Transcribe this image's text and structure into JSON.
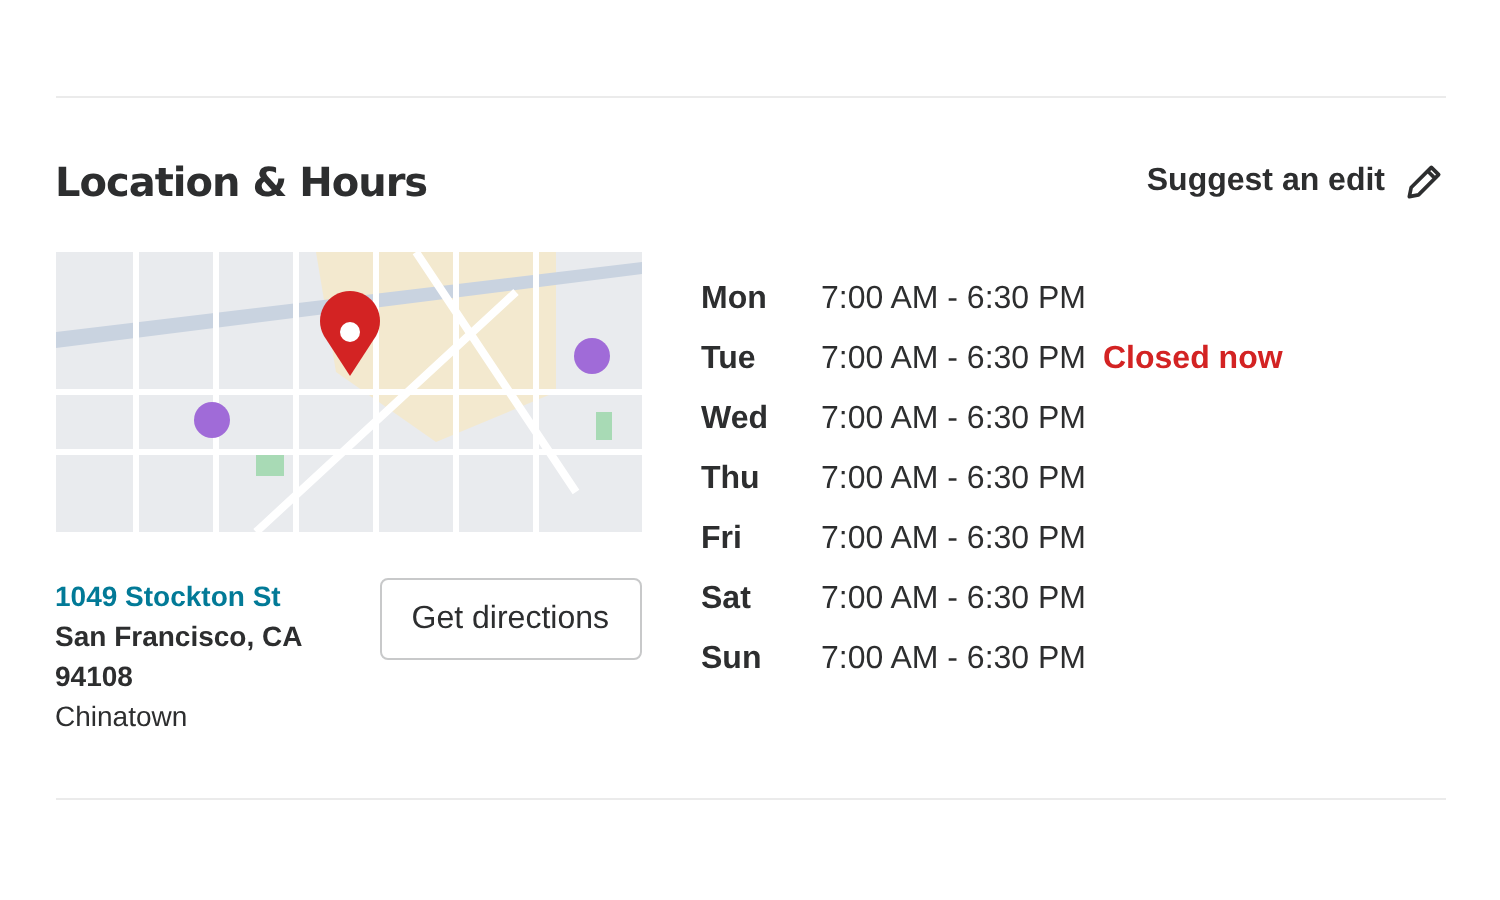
{
  "section": {
    "title": "Location & Hours",
    "suggest_edit": "Suggest an edit"
  },
  "address": {
    "street": "1049 Stockton St",
    "lines": [
      "San Francisco, CA",
      "94108",
      "Chinatown"
    ]
  },
  "directions_button": "Get directions",
  "hours": [
    {
      "day": "Mon",
      "time": "7:00 AM - 6:30 PM"
    },
    {
      "day": "Tue",
      "time": "7:00 AM - 6:30 PM",
      "status": "Closed now"
    },
    {
      "day": "Wed",
      "time": "7:00 AM - 6:30 PM"
    },
    {
      "day": "Thu",
      "time": "7:00 AM - 6:30 PM"
    },
    {
      "day": "Fri",
      "time": "7:00 AM - 6:30 PM"
    },
    {
      "day": "Sat",
      "time": "7:00 AM - 6:30 PM"
    },
    {
      "day": "Sun",
      "time": "7:00 AM - 6:30 PM"
    }
  ]
}
